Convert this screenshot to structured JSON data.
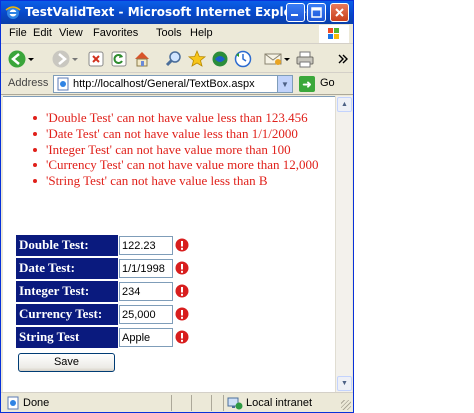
{
  "window": {
    "title": "TestValidText - Microsoft Internet Explorer"
  },
  "menu": {
    "items": [
      "File",
      "Edit",
      "View",
      "Favorites",
      "Tools",
      "Help"
    ]
  },
  "toolbar": {
    "icons": [
      "back-icon",
      "forward-icon",
      "stop-icon",
      "refresh-icon",
      "home-icon",
      "search-icon",
      "favorites-icon",
      "media-icon",
      "history-icon",
      "mail-icon",
      "print-icon"
    ]
  },
  "address": {
    "label": "Address",
    "url": "http://localhost/General/TextBox.aspx",
    "go_label": "Go"
  },
  "errors": [
    "'Double Test' can not have value less than 123.456",
    "'Date Test' can not have value less than 1/1/2000",
    "'Integer Test' can not have value more than 100",
    "'Currency Test' can not have value more than 12,000",
    "'String Test' can not have value less than B"
  ],
  "form": {
    "rows": [
      {
        "label": "Double Test:",
        "value": "122.23"
      },
      {
        "label": "Date Test:",
        "value": "1/1/1998"
      },
      {
        "label": "Integer Test:",
        "value": "234"
      },
      {
        "label": "Currency Test:",
        "value": "25,000"
      },
      {
        "label": "String Test",
        "value": "Apple"
      }
    ],
    "save_label": "Save"
  },
  "status": {
    "text": "Done",
    "zone": "Local intranet"
  },
  "colors": {
    "error_text": "#e0201a",
    "label_bg": "#0a1a7e",
    "title_bar": "#0a4fd8"
  }
}
